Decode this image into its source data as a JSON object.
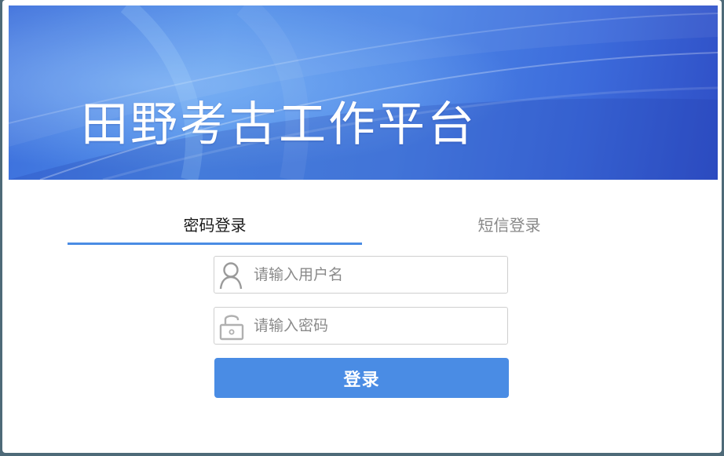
{
  "banner": {
    "title": "田野考古工作平台"
  },
  "tabs": [
    {
      "label": "密码登录",
      "active": true
    },
    {
      "label": "短信登录",
      "active": false
    }
  ],
  "form": {
    "username": {
      "placeholder": "请输入用户名",
      "value": "",
      "icon": "user-icon"
    },
    "password": {
      "placeholder": "请输入密码",
      "value": "",
      "icon": "lock-icon"
    },
    "submit_label": "登录"
  },
  "colors": {
    "accent": "#4a8ce4",
    "banner_dark": "#2f4fc6",
    "banner_light": "#4f8de8",
    "backdrop": "#4e6a78"
  }
}
